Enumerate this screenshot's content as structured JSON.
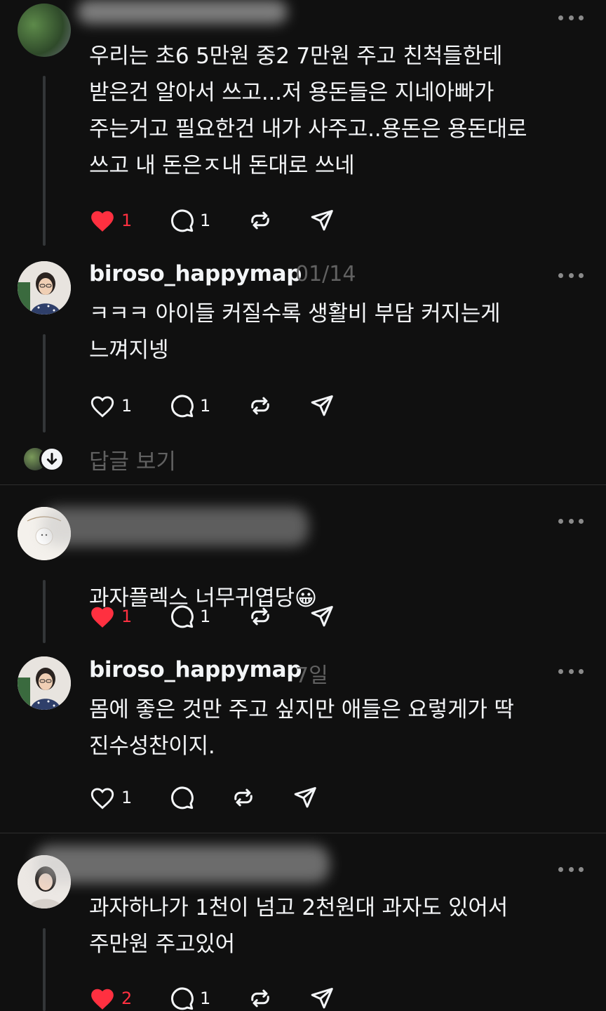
{
  "comments": [
    {
      "username": "",
      "time": "",
      "text": "우리는 초6  5만원  중2 7만원 주고 친척들한테\n받은건 알아서 쓰고...저 용돈들은 지네아빠가\n주는거고 필요한건 내가 사주고..용돈은 용돈대로\n쓰고 내 돈은ㅈ내 돈대로 쓰네",
      "likes": "1",
      "replies": "1",
      "liked": true
    },
    {
      "username": "biroso_happymap",
      "time": "01/14",
      "text": "ㅋㅋㅋ 아이들 커질수록 생활비 부담 커지는게\n느껴지넹",
      "likes": "1",
      "replies": "1",
      "liked": false
    },
    {
      "username": "",
      "time": "",
      "text": "과자플렉스 너무귀엽당",
      "emoji": "😀",
      "likes": "1",
      "replies": "1",
      "liked": true
    },
    {
      "username": "biroso_happymap",
      "time": "7일",
      "text": "몸에 좋은 것만 주고 싶지만 애들은 요렇게가 딱\n진수성찬이지.",
      "likes": "1",
      "replies": "",
      "liked": false
    },
    {
      "username": "",
      "time": "",
      "text": "과자하나가  1천이 넘고 2천원대 과자도 있어서\n주만원 주고있어",
      "likes": "2",
      "replies": "1",
      "liked": true
    }
  ],
  "view_replies_label": "답글 보기",
  "icons": {
    "like": "heart-icon",
    "comment": "comment-bubble-icon",
    "repost": "repost-icon",
    "share": "send-icon",
    "more": "more-dots-icon",
    "expand": "arrow-down-circle-icon"
  },
  "colors": {
    "background": "#101010",
    "text": "#f3f5f7",
    "secondary_text": "#616161",
    "like_red": "#ff3040",
    "thread_line": "#333638",
    "divider": "#2e2e2e"
  }
}
